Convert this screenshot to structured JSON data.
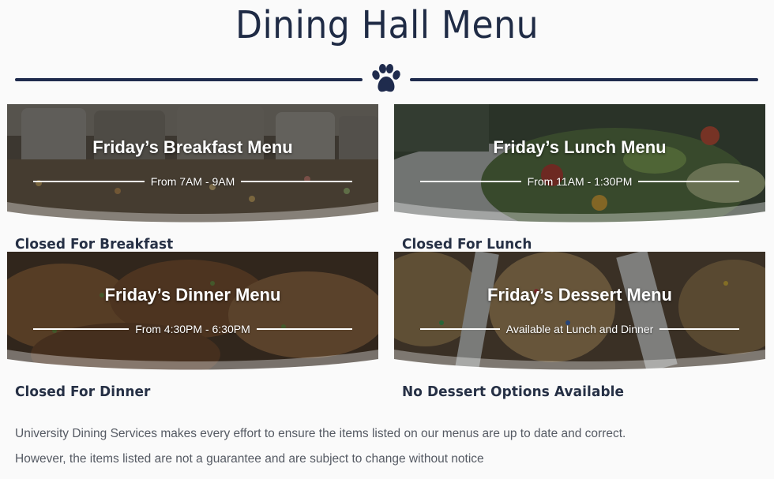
{
  "page": {
    "title": "Dining Hall Menu",
    "divider_icon": "paw-print-icon",
    "brand_color": "#1f2b4d"
  },
  "cards": [
    {
      "title": "Friday’s Breakfast Menu",
      "hours": "From 7AM - 9AM",
      "status": "Closed For Breakfast",
      "photo": "cereal dispensers"
    },
    {
      "title": "Friday’s Lunch Menu",
      "hours": "From 11AM - 1:30PM",
      "status": "Closed For Lunch",
      "photo": "salad bowl"
    },
    {
      "title": "Friday’s Dinner Menu",
      "hours": "From 4:30PM - 6:30PM",
      "status": "Closed For Dinner",
      "photo": "glazed chicken"
    },
    {
      "title": "Friday’s Dessert Menu",
      "hours": "Available at Lunch and Dinner",
      "status": "No Dessert Options Available",
      "photo": "cookies"
    }
  ],
  "disclaimer": {
    "line1": "University Dining Services makes every effort to ensure the items listed on our menus are up to date and correct.",
    "line2": "However, the items listed are not a guarantee and are subject to change without notice"
  }
}
